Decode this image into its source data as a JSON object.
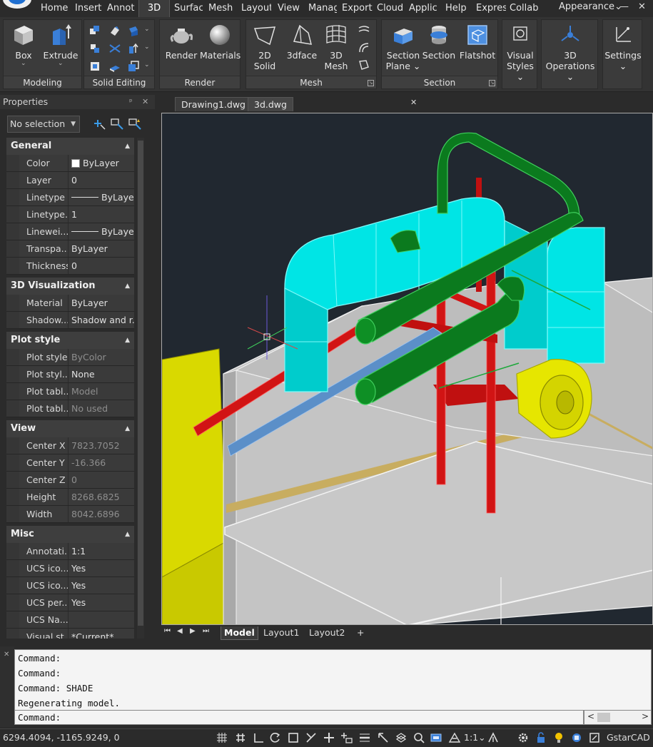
{
  "menu": {
    "tabs": [
      {
        "label": "Home"
      },
      {
        "label": "Insert"
      },
      {
        "label": "Annot"
      },
      {
        "label": "3D"
      },
      {
        "label": "Surfac"
      },
      {
        "label": "Mesh"
      },
      {
        "label": "Layout"
      },
      {
        "label": "View"
      },
      {
        "label": "Manag"
      },
      {
        "label": "Export"
      },
      {
        "label": "Cloud"
      },
      {
        "label": "Applic"
      },
      {
        "label": "Help"
      },
      {
        "label": "Expres"
      },
      {
        "label": "Collab"
      }
    ],
    "active_tab": "3D",
    "appearance": "Appearance",
    "caret": "⌄",
    "minimize": "—",
    "close": "✕"
  },
  "ribbon": {
    "modeling": {
      "title": "Modeling",
      "box": "Box",
      "extrude": "Extrude",
      "caret": "⌄"
    },
    "solid_editing": {
      "title": "Solid Editing"
    },
    "render": {
      "title": "Render",
      "render": "Render",
      "materials": "Materials"
    },
    "mesh": {
      "title": "Mesh",
      "solid": "2D\nSolid",
      "solid_l1": "2D",
      "solid_l2": "Solid",
      "face": "3dface",
      "mesh_l1": "3D",
      "mesh_l2": "Mesh"
    },
    "section": {
      "title": "Section",
      "plane_l1": "Section",
      "plane_l2": "Plane ⌄",
      "section": "Section",
      "flatshot": "Flatshot"
    },
    "visual": {
      "l1": "Visual",
      "l2": "Styles ⌄"
    },
    "ops": {
      "l1": "3D",
      "l2": "Operations ⌄"
    },
    "settings": {
      "label": "Settings",
      "caret": "⌄"
    }
  },
  "properties": {
    "title": "Properties",
    "pin": "ᵖ",
    "close": "✕",
    "selection": "No selection",
    "caret": "▼",
    "collapse": "▲",
    "categories": {
      "general": "General",
      "visualization": "3D Visualization",
      "plotstyle": "Plot style",
      "view": "View",
      "misc": "Misc"
    },
    "general": [
      {
        "name": "Color",
        "value": "ByLayer"
      },
      {
        "name": "Layer",
        "value": "0"
      },
      {
        "name": "Linetype",
        "value": "ByLayer"
      },
      {
        "name": "Linetype...",
        "value": "1"
      },
      {
        "name": "Linewei...",
        "value": "ByLayer"
      },
      {
        "name": "Transpa...",
        "value": "ByLayer"
      },
      {
        "name": "Thickness",
        "value": "0"
      }
    ],
    "visualization": [
      {
        "name": "Material",
        "value": "ByLayer"
      },
      {
        "name": "Shadow...",
        "value": "Shadow and r..."
      }
    ],
    "plotstyle": [
      {
        "name": "Plot style",
        "value": "ByColor"
      },
      {
        "name": "Plot styl...",
        "value": "None"
      },
      {
        "name": "Plot tabl...",
        "value": "Model"
      },
      {
        "name": "Plot tabl...",
        "value": "No used"
      }
    ],
    "view": [
      {
        "name": "Center X",
        "value": "7823.7052"
      },
      {
        "name": "Center Y",
        "value": "-16.366"
      },
      {
        "name": "Center Z",
        "value": "0"
      },
      {
        "name": "Height",
        "value": "8268.6825"
      },
      {
        "name": "Width",
        "value": "8042.6896"
      }
    ],
    "misc": [
      {
        "name": "Annotati...",
        "value": "1:1"
      },
      {
        "name": "UCS ico...",
        "value": "Yes"
      },
      {
        "name": "UCS ico...",
        "value": "Yes"
      },
      {
        "name": "UCS per...",
        "value": "Yes"
      },
      {
        "name": "UCS Na...",
        "value": ""
      },
      {
        "name": "Visual st...",
        "value": "*Current*"
      }
    ]
  },
  "documents": {
    "tabs": [
      {
        "label": "Drawing1.dwg"
      },
      {
        "label": "3d.dwg"
      }
    ],
    "close": "✕"
  },
  "layout_tabs": {
    "tabs": [
      {
        "label": "Model"
      },
      {
        "label": "Layout1"
      },
      {
        "label": "Layout2"
      }
    ],
    "add": "+",
    "first": "⏮",
    "prev": "◀",
    "next": "▶",
    "last": "⏭"
  },
  "command": {
    "history": [
      "Command:",
      "Command:",
      "Command: SHADE",
      "Regenerating model."
    ],
    "prompt": "Command:",
    "scroll_left": "<",
    "scroll_right": ">"
  },
  "status": {
    "coords": "6294.4094, -1165.9249, 0",
    "scale": "1:1",
    "scale_caret": "⌄",
    "brand": "GstarCAD"
  },
  "colors": {
    "duct": "#00e5e5",
    "pipe": "#0b7a1e",
    "frame": "#d11414",
    "beam": "#5b8fc8",
    "fan": "#e6e600",
    "platform": "#c4c4c4",
    "background": "#212830"
  }
}
